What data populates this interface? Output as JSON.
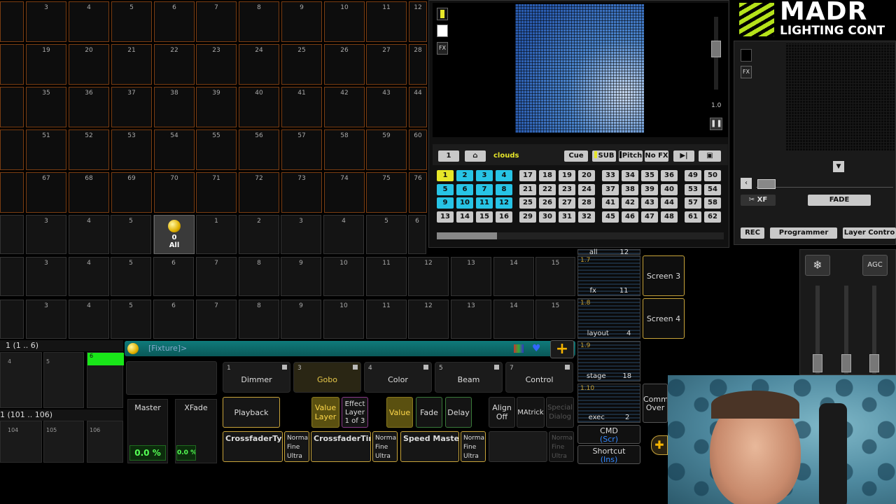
{
  "grid": {
    "rows": [
      [
        "3",
        "4",
        "5",
        "6",
        "7",
        "8",
        "9",
        "10",
        "11",
        "12"
      ],
      [
        "19",
        "20",
        "21",
        "22",
        "23",
        "24",
        "25",
        "26",
        "27",
        "28"
      ],
      [
        "35",
        "36",
        "37",
        "38",
        "39",
        "40",
        "41",
        "42",
        "43",
        "44"
      ],
      [
        "51",
        "52",
        "53",
        "54",
        "55",
        "56",
        "57",
        "58",
        "59",
        "60"
      ],
      [
        "67",
        "68",
        "69",
        "70",
        "71",
        "72",
        "73",
        "74",
        "75",
        "76"
      ]
    ],
    "row6": [
      "3",
      "4",
      "5",
      "",
      "1",
      "2",
      "3",
      "4",
      "5",
      "6"
    ],
    "row7": [
      "3",
      "4",
      "5",
      "6",
      "7",
      "8",
      "9",
      "10",
      "11",
      "12",
      "13",
      "14",
      "15"
    ],
    "row8": [
      "3",
      "4",
      "5",
      "6",
      "7",
      "8",
      "9",
      "10",
      "11",
      "12",
      "13",
      "14",
      "15"
    ],
    "group_all_count": "0",
    "group_all_label": "All"
  },
  "left_panel": {
    "range1": "1 (1 .. 6)",
    "range1_cells": [
      "4",
      "5",
      "6"
    ],
    "range2": "1 (101 .. 106)",
    "range2_cells": [
      "104",
      "105",
      "106"
    ]
  },
  "command_bar": {
    "text": "[Fixture]>",
    "plus_icon": "plus-icon"
  },
  "feature_tabs": [
    {
      "num": "1",
      "label": "Dimmer"
    },
    {
      "num": "3",
      "label": "Gobo"
    },
    {
      "num": "4",
      "label": "Color"
    },
    {
      "num": "5",
      "label": "Beam"
    },
    {
      "num": "7",
      "label": "Control"
    }
  ],
  "master": {
    "label": "Master",
    "value": "0.0 %",
    "xfade_label": "XFade",
    "xfade_value": "0.0 %"
  },
  "buttons_row1": {
    "playback": "Playback",
    "value_layer": "Value Layer",
    "effect_layer": "Effect Layer 1 of 3",
    "value": "Value",
    "fade": "Fade",
    "delay": "Delay",
    "align": "Align Off",
    "matrix": "MAtrick",
    "special": "Special Dialog"
  },
  "buttons_row2": {
    "crossfader_type": "CrossfaderTyp",
    "normal1": "Norma Fine Ultra",
    "crossfader_time": "CrossfaderTim",
    "normal2": "Norma Fine Ultra",
    "speed_master": "Speed Master",
    "normal3": "Norma Fine Ultra",
    "normal4": "Norma Fine Ultra"
  },
  "thumbs": [
    {
      "num": "",
      "label": "all",
      "val": "12"
    },
    {
      "num": "1.7",
      "label": "fx",
      "val": "11"
    },
    {
      "num": "1.8",
      "label": "layout",
      "val": "4"
    },
    {
      "num": "1.9",
      "label": "stage",
      "val": "18"
    },
    {
      "num": "1.10",
      "label": "exec",
      "val": "2"
    }
  ],
  "screens": [
    "Screen 3",
    "Screen 4"
  ],
  "cmd": {
    "label": "CMD",
    "sub": "(Scr)"
  },
  "shortcut": {
    "label": "Shortcut",
    "sub": "(Ins)"
  },
  "comm": "Comm Over",
  "preview": {
    "fx": "FX",
    "speed_value": "1.0",
    "pause_icon": "pause-icon"
  },
  "media_toolbar": {
    "page": "1",
    "home_icon": "home-icon",
    "title": "clouds",
    "cue": "Cue",
    "sub": "SUB",
    "pitch": "Pitch",
    "nofx": "No FX",
    "skip_icon": "skip-icon",
    "next_icon": "panel-icon"
  },
  "media_keys": {
    "g1": [
      [
        "1",
        "2",
        "3",
        "4"
      ],
      [
        "5",
        "6",
        "7",
        "8"
      ],
      [
        "9",
        "10",
        "11",
        "12"
      ],
      [
        "13",
        "14",
        "15",
        "16"
      ]
    ],
    "g2": [
      [
        "17",
        "18",
        "19",
        "20"
      ],
      [
        "21",
        "22",
        "23",
        "24"
      ],
      [
        "25",
        "26",
        "27",
        "28"
      ],
      [
        "29",
        "30",
        "31",
        "32"
      ]
    ],
    "g3": [
      [
        "33",
        "34",
        "35",
        "36"
      ],
      [
        "37",
        "38",
        "39",
        "40"
      ],
      [
        "41",
        "42",
        "43",
        "44"
      ],
      [
        "45",
        "46",
        "47",
        "48"
      ]
    ],
    "g4": [
      [
        "49",
        "50"
      ],
      [
        "53",
        "54"
      ],
      [
        "57",
        "58"
      ],
      [
        "61",
        "62"
      ]
    ]
  },
  "logo": {
    "line1": "MADR",
    "line2": "LIGHTING CONT"
  },
  "right_panel": {
    "fx": "FX",
    "xf": "XF",
    "fade": "FADE",
    "rec": "REC",
    "programmer": "Programmer",
    "layer_control": "Layer Contro",
    "agc": "AGC",
    "snow_icon": "snowflake-icon"
  },
  "colors": {
    "accent_orange": "#7a3d12",
    "cyan": "#27c4e6",
    "yellow": "#e6e629",
    "green": "#19e619",
    "teal": "#0f6f6f"
  }
}
